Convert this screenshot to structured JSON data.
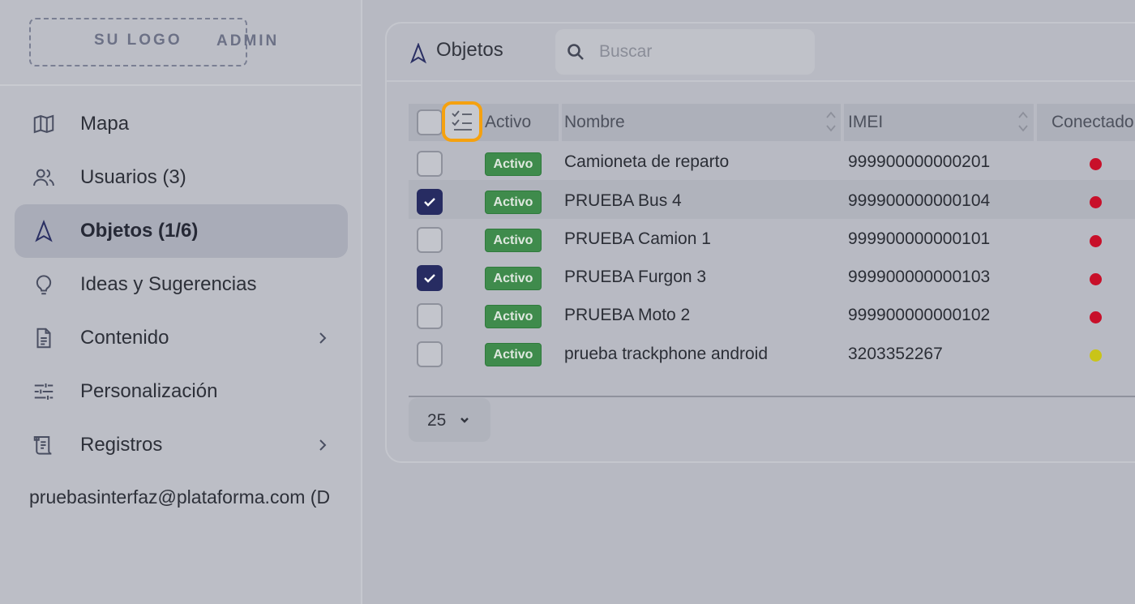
{
  "sidebar": {
    "logo_text": "SU LOGO",
    "admin_text": "ADMIN",
    "items": [
      {
        "label": "Mapa",
        "icon": "map-icon"
      },
      {
        "label": "Usuarios (3)",
        "icon": "users-icon"
      },
      {
        "label": "Objetos (1/6)",
        "icon": "navigation-arrow-icon",
        "active": true
      },
      {
        "label": "Ideas y Sugerencias",
        "icon": "lightbulb-icon"
      },
      {
        "label": "Contenido",
        "icon": "document-icon",
        "has_submenu": true
      },
      {
        "label": "Personalización",
        "icon": "sliders-icon"
      },
      {
        "label": "Registros",
        "icon": "scroll-icon",
        "has_submenu": true
      }
    ],
    "user_email": "pruebasinterfaz@plataforma.com (D"
  },
  "panel": {
    "title": "Objetos",
    "title_icon": "navigation-arrow-icon",
    "search": {
      "placeholder": "Buscar",
      "value": ""
    }
  },
  "table": {
    "columns": [
      "Activo",
      "Nombre",
      "IMEI",
      "Conectado"
    ],
    "rows": [
      {
        "checked": false,
        "status": "Activo",
        "name": "Camioneta de reparto",
        "imei": "999900000000201",
        "connected_color": "#c8102a"
      },
      {
        "checked": true,
        "status": "Activo",
        "name": "PRUEBA Bus 4",
        "imei": "999900000000104",
        "connected_color": "#c8102a"
      },
      {
        "checked": false,
        "status": "Activo",
        "name": "PRUEBA Camion 1",
        "imei": "999900000000101",
        "connected_color": "#c8102a"
      },
      {
        "checked": true,
        "status": "Activo",
        "name": "PRUEBA Furgon 3",
        "imei": "999900000000103",
        "connected_color": "#c8102a"
      },
      {
        "checked": false,
        "status": "Activo",
        "name": "PRUEBA Moto 2",
        "imei": "999900000000102",
        "connected_color": "#c8102a"
      },
      {
        "checked": false,
        "status": "Activo",
        "name": "prueba trackphone android",
        "imei": "3203352267",
        "connected_color": "#c9c418"
      }
    ],
    "page_size": "25"
  },
  "colors": {
    "accent": "#272c62",
    "badge_green": "#3f8b4c",
    "highlight_ring": "#f5a10f"
  }
}
